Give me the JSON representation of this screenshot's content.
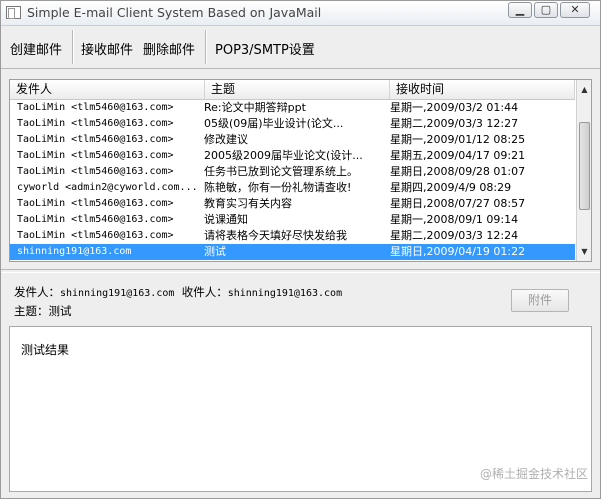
{
  "window": {
    "title": "Simple E-mail Client System Based on JavaMail"
  },
  "toolbar": {
    "create": "创建邮件",
    "receive": "接收邮件",
    "delete": "删除邮件",
    "settings": "POP3/SMTP设置"
  },
  "table": {
    "headers": [
      "发件人",
      "主题",
      "接收时间"
    ],
    "rows": [
      [
        "TaoLiMin <tlm5460@163.com>",
        "Re:论文中期答辩ppt",
        "星期一,2009/03/2 01:44"
      ],
      [
        "TaoLiMin <tlm5460@163.com>",
        "05级(09届)毕业设计(论文...",
        "星期二,2009/03/3 12:27"
      ],
      [
        "TaoLiMin <tlm5460@163.com>",
        "修改建议",
        "星期一,2009/01/12 08:25"
      ],
      [
        "TaoLiMin <tlm5460@163.com>",
        "2005级2009届毕业论文(设计...",
        "星期五,2009/04/17 09:21"
      ],
      [
        "TaoLiMin <tlm5460@163.com>",
        "任务书已放到论文管理系统上。",
        "星期日,2008/09/28 01:07"
      ],
      [
        "cyworld <admin2@cyworld.com...",
        "陈艳敏，你有一份礼物请查收!",
        "星期四,2009/4/9 08:29"
      ],
      [
        "TaoLiMin <tlm5460@163.com>",
        "教育实习有关内容",
        "星期日,2008/07/27 08:57"
      ],
      [
        "TaoLiMin <tlm5460@163.com>",
        "说课通知",
        "星期一,2008/09/1 09:14"
      ],
      [
        "TaoLiMin <tlm5460@163.com>",
        "请将表格今天填好尽快发给我",
        "星期二,2009/03/3 12:24"
      ],
      [
        "shinning191@163.com",
        "测试",
        "星期日,2009/04/19 01:22"
      ]
    ],
    "selected_index": 9
  },
  "details": {
    "from_label": "发件人：",
    "from_value": "shinning191@163.com",
    "to_label": "收件人：",
    "to_value": "shinning191@163.com",
    "subject_label": "主题：",
    "subject_value": "测试",
    "attach_label": "附件"
  },
  "body": {
    "text": "测试结果"
  },
  "watermark": "@稀土掘金技术社区",
  "colors": {
    "selection": "#3399ff",
    "window_bg": "#eeeeee"
  }
}
